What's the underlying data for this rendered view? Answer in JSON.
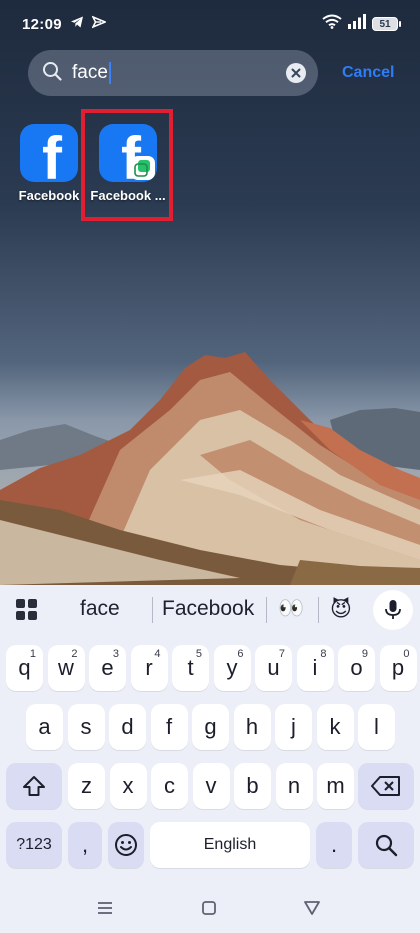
{
  "status_bar": {
    "time": "12:09",
    "battery_level": "51",
    "notification_icons": [
      "telegram-icon",
      "send-icon"
    ],
    "system_icons": [
      "wifi-icon",
      "signal-icon",
      "battery-icon"
    ]
  },
  "search": {
    "query": "face",
    "clear_icon": "clear-icon",
    "cancel_label": "Cancel"
  },
  "results": [
    {
      "label": "Facebook",
      "icon": "facebook-icon",
      "clone": false
    },
    {
      "label": "Facebook ...",
      "icon": "facebook-clone-icon",
      "clone": true,
      "highlighted": true
    }
  ],
  "keyboard": {
    "suggestions": [
      "face",
      "Facebook",
      "👀",
      "😈"
    ],
    "row1": [
      {
        "key": "q",
        "hint": "1"
      },
      {
        "key": "w",
        "hint": "2"
      },
      {
        "key": "e",
        "hint": "3"
      },
      {
        "key": "r",
        "hint": "4"
      },
      {
        "key": "t",
        "hint": "5"
      },
      {
        "key": "y",
        "hint": "6"
      },
      {
        "key": "u",
        "hint": "7"
      },
      {
        "key": "i",
        "hint": "8"
      },
      {
        "key": "o",
        "hint": "9"
      },
      {
        "key": "p",
        "hint": "0"
      }
    ],
    "row2": [
      "a",
      "s",
      "d",
      "f",
      "g",
      "h",
      "j",
      "k",
      "l"
    ],
    "row3": [
      "z",
      "x",
      "c",
      "v",
      "b",
      "n",
      "m"
    ],
    "symbols_label": "?123",
    "comma_label": ",",
    "space_label": "English",
    "period_label": "."
  },
  "colors": {
    "accent": "#2f7df6",
    "facebook_blue": "#1877f2",
    "highlight_border": "#e02030",
    "keyboard_bg": "#eceef8"
  }
}
